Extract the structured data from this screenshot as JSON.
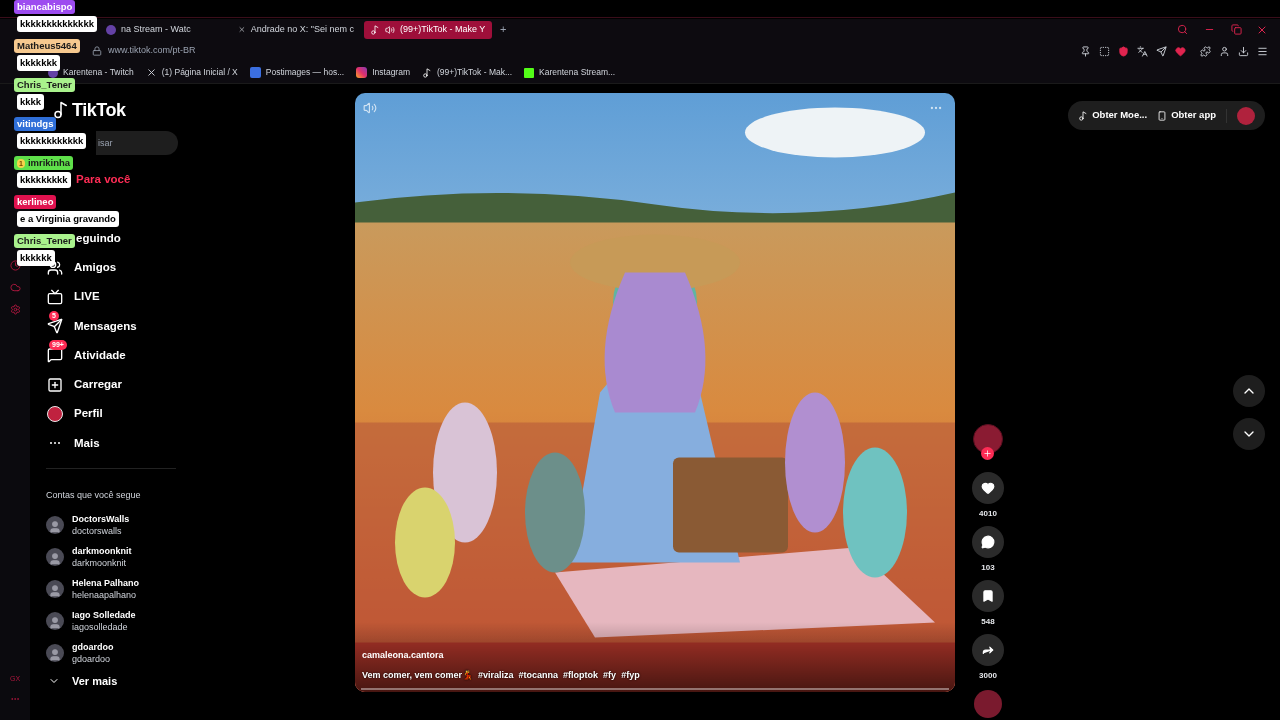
{
  "browser": {
    "tabs": [
      {
        "title": "na Stream - Watc",
        "selected": false,
        "kind": "plain"
      },
      {
        "title": "Andrade no X: \"Sei nem c",
        "selected": false,
        "kind": "x"
      },
      {
        "title": "(99+)TikTok - Make Y",
        "selected": true,
        "kind": "tiktok"
      }
    ],
    "new_tab": "+",
    "address": "www.tiktok.com/pt-BR",
    "bookmarks": [
      {
        "title": "Karentena - Twitch",
        "kind": "plain"
      },
      {
        "title": "(1) Página Inicial / X",
        "kind": "x"
      },
      {
        "title": "Postimages — hos...",
        "kind": "postimages"
      },
      {
        "title": "Instagram",
        "kind": "instagram"
      },
      {
        "title": "(99+)TikTok - Mak...",
        "kind": "tiktok"
      },
      {
        "title": "Karentena Stream...",
        "kind": "kick"
      }
    ],
    "sidebar_label": "GX"
  },
  "tiktok": {
    "logo": "TikTok",
    "search": {
      "placeholder": "isar"
    },
    "nav": [
      {
        "label": "Para você",
        "kind": "covered",
        "selected": true
      },
      {
        "label": "eguindo",
        "kind": "covered",
        "selected": false
      },
      {
        "label": "Amigos",
        "kind": "friends",
        "selected": false
      },
      {
        "label": "LIVE",
        "kind": "live",
        "selected": false
      },
      {
        "label": "Mensagens",
        "kind": "messages",
        "selected": false,
        "badge": "5"
      },
      {
        "label": "Atividade",
        "kind": "activity",
        "selected": false,
        "badge": "99+"
      },
      {
        "label": "Carregar",
        "kind": "upload",
        "selected": false
      },
      {
        "label": "Perfil",
        "kind": "profile",
        "selected": false
      },
      {
        "label": "Mais",
        "kind": "more",
        "selected": false
      }
    ],
    "following_title": "Contas que você segue",
    "accounts": [
      {
        "name": "DoctorsWalls",
        "handle": "doctorswalls"
      },
      {
        "name": "darkmoonknit",
        "handle": "darkmoonknit"
      },
      {
        "name": "Helena Palhano",
        "handle": "helenaapalhano"
      },
      {
        "name": "Iago Solledade",
        "handle": "iagosolledade"
      },
      {
        "name": "gdoardoo",
        "handle": "gdoardoo"
      }
    ],
    "see_more": "Ver mais",
    "top_actions": [
      {
        "label": "Obter Moe...",
        "kind": "coins"
      },
      {
        "label": "Obter app",
        "kind": "app"
      }
    ]
  },
  "video": {
    "kind": "picture",
    "author": "camaleona.cantora",
    "caption": "Vem comer, vem comer💃",
    "hashtags": [
      "#viraliza",
      "#tocanna",
      "#floptok",
      "#fy",
      "#fyp"
    ],
    "actions": [
      {
        "kind": "like",
        "count": "4010"
      },
      {
        "kind": "comment",
        "count": "103"
      },
      {
        "kind": "save",
        "count": "548"
      },
      {
        "kind": "share",
        "count": "3000"
      }
    ]
  },
  "chat": [
    {
      "user": "biancabispo",
      "color": "#9d4cf0",
      "message": "kkkkkkkkkkkkkk"
    },
    {
      "user": "Matheus5464",
      "color": "#f6c98f",
      "message": "kkkkkkk"
    },
    {
      "user": "Chris_Tener",
      "color": "#a9f28c",
      "message": "kkkk"
    },
    {
      "user": "vitindgs",
      "color": "#2f6fd8",
      "message": "kkkkkkkkkkkk"
    },
    {
      "user": "imrikinha",
      "color": "#5fe04a",
      "badge": "1",
      "message": "kkkkkkkkk"
    },
    {
      "user": "kerlineo",
      "color": "#e0124f",
      "message": "e a Virginia gravando"
    },
    {
      "user": "Chris_Tener",
      "color": "#a9f28c",
      "message": "kkkkkk"
    }
  ]
}
